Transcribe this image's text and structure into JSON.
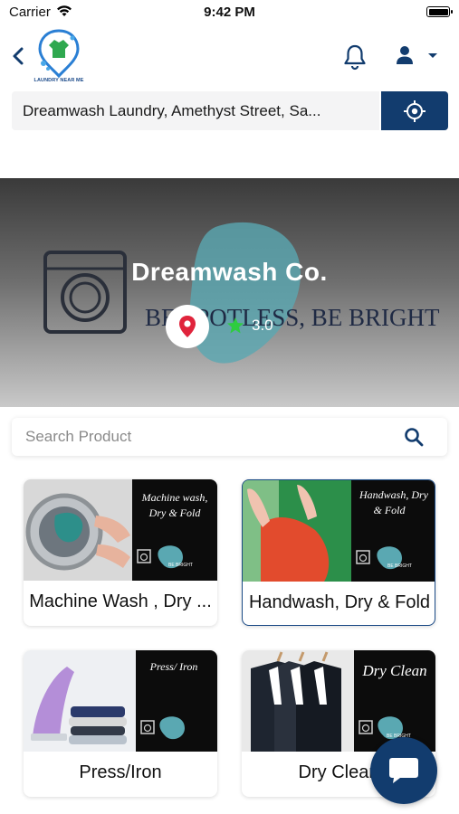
{
  "status_bar": {
    "carrier": "Carrier",
    "time": "9:42 PM"
  },
  "header": {
    "logo_text": "LAUNDRY NEAR ME"
  },
  "address": {
    "value": "Dreamwash Laundry, Amethyst Street, Sa..."
  },
  "shop": {
    "name": "Dreamwash Co.",
    "rating": "3.0",
    "banner_tagline": "BE SPOTLESS, BE BRIGHT"
  },
  "search": {
    "placeholder": "Search Product"
  },
  "products": [
    {
      "label": "Machine Wash , Dry ...",
      "image_caption_1": "Machine wash,",
      "image_caption_2": "Dry & Fold",
      "image_tag": "BE BRIGHT"
    },
    {
      "label": "Handwash, Dry & Fold",
      "image_caption_1": "Handwash, Dry",
      "image_caption_2": "& Fold",
      "image_tag": "BE BRIGHT"
    },
    {
      "label": "Press/Iron",
      "image_caption_1": "Press/ Iron",
      "image_caption_2": "",
      "image_tag": ""
    },
    {
      "label": "Dry Clean",
      "image_caption_1": "Dry Clean",
      "image_caption_2": "",
      "image_tag": "BE BRIGHT"
    }
  ],
  "colors": {
    "primary": "#123c6e",
    "accent_star": "#2ecc40",
    "pin_red": "#e0243c",
    "banner_blob": "#5aa8b2"
  },
  "icons": [
    "back-arrow-icon",
    "bell-icon",
    "user-icon",
    "chevron-down-icon",
    "locate-icon",
    "map-pin-icon",
    "star-icon",
    "search-icon",
    "chat-icon"
  ]
}
